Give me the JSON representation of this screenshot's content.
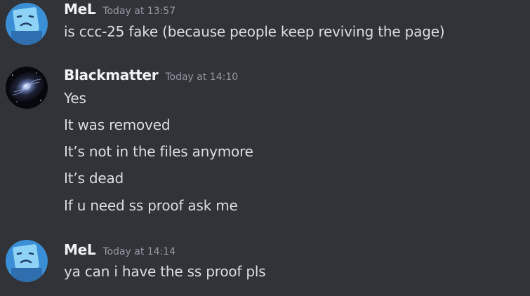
{
  "messages": [
    {
      "author": "MeL",
      "time": "Today at 13:57",
      "avatar_icon": "blue-square-face-avatar",
      "lines": [
        "is ccc-25 fake (because people keep reviving the page)"
      ]
    },
    {
      "author": "Blackmatter",
      "time": "Today at 14:10",
      "avatar_icon": "galaxy-avatar",
      "lines": [
        "Yes",
        "It was removed",
        "It’s not in the files anymore",
        "It’s dead",
        "If u need ss proof ask me"
      ]
    },
    {
      "author": "MeL",
      "time": "Today at 14:14",
      "avatar_icon": "blue-square-face-avatar",
      "lines": [
        "ya can i have the ss proof pls"
      ]
    }
  ],
  "colors": {
    "background": "#313338",
    "username": "#f2f3f5",
    "timestamp": "#949ba4",
    "message_text": "#dbdee1",
    "mel_avatar_bg": "#3a8fd6",
    "mel_avatar_face": "#8ed3f5"
  }
}
